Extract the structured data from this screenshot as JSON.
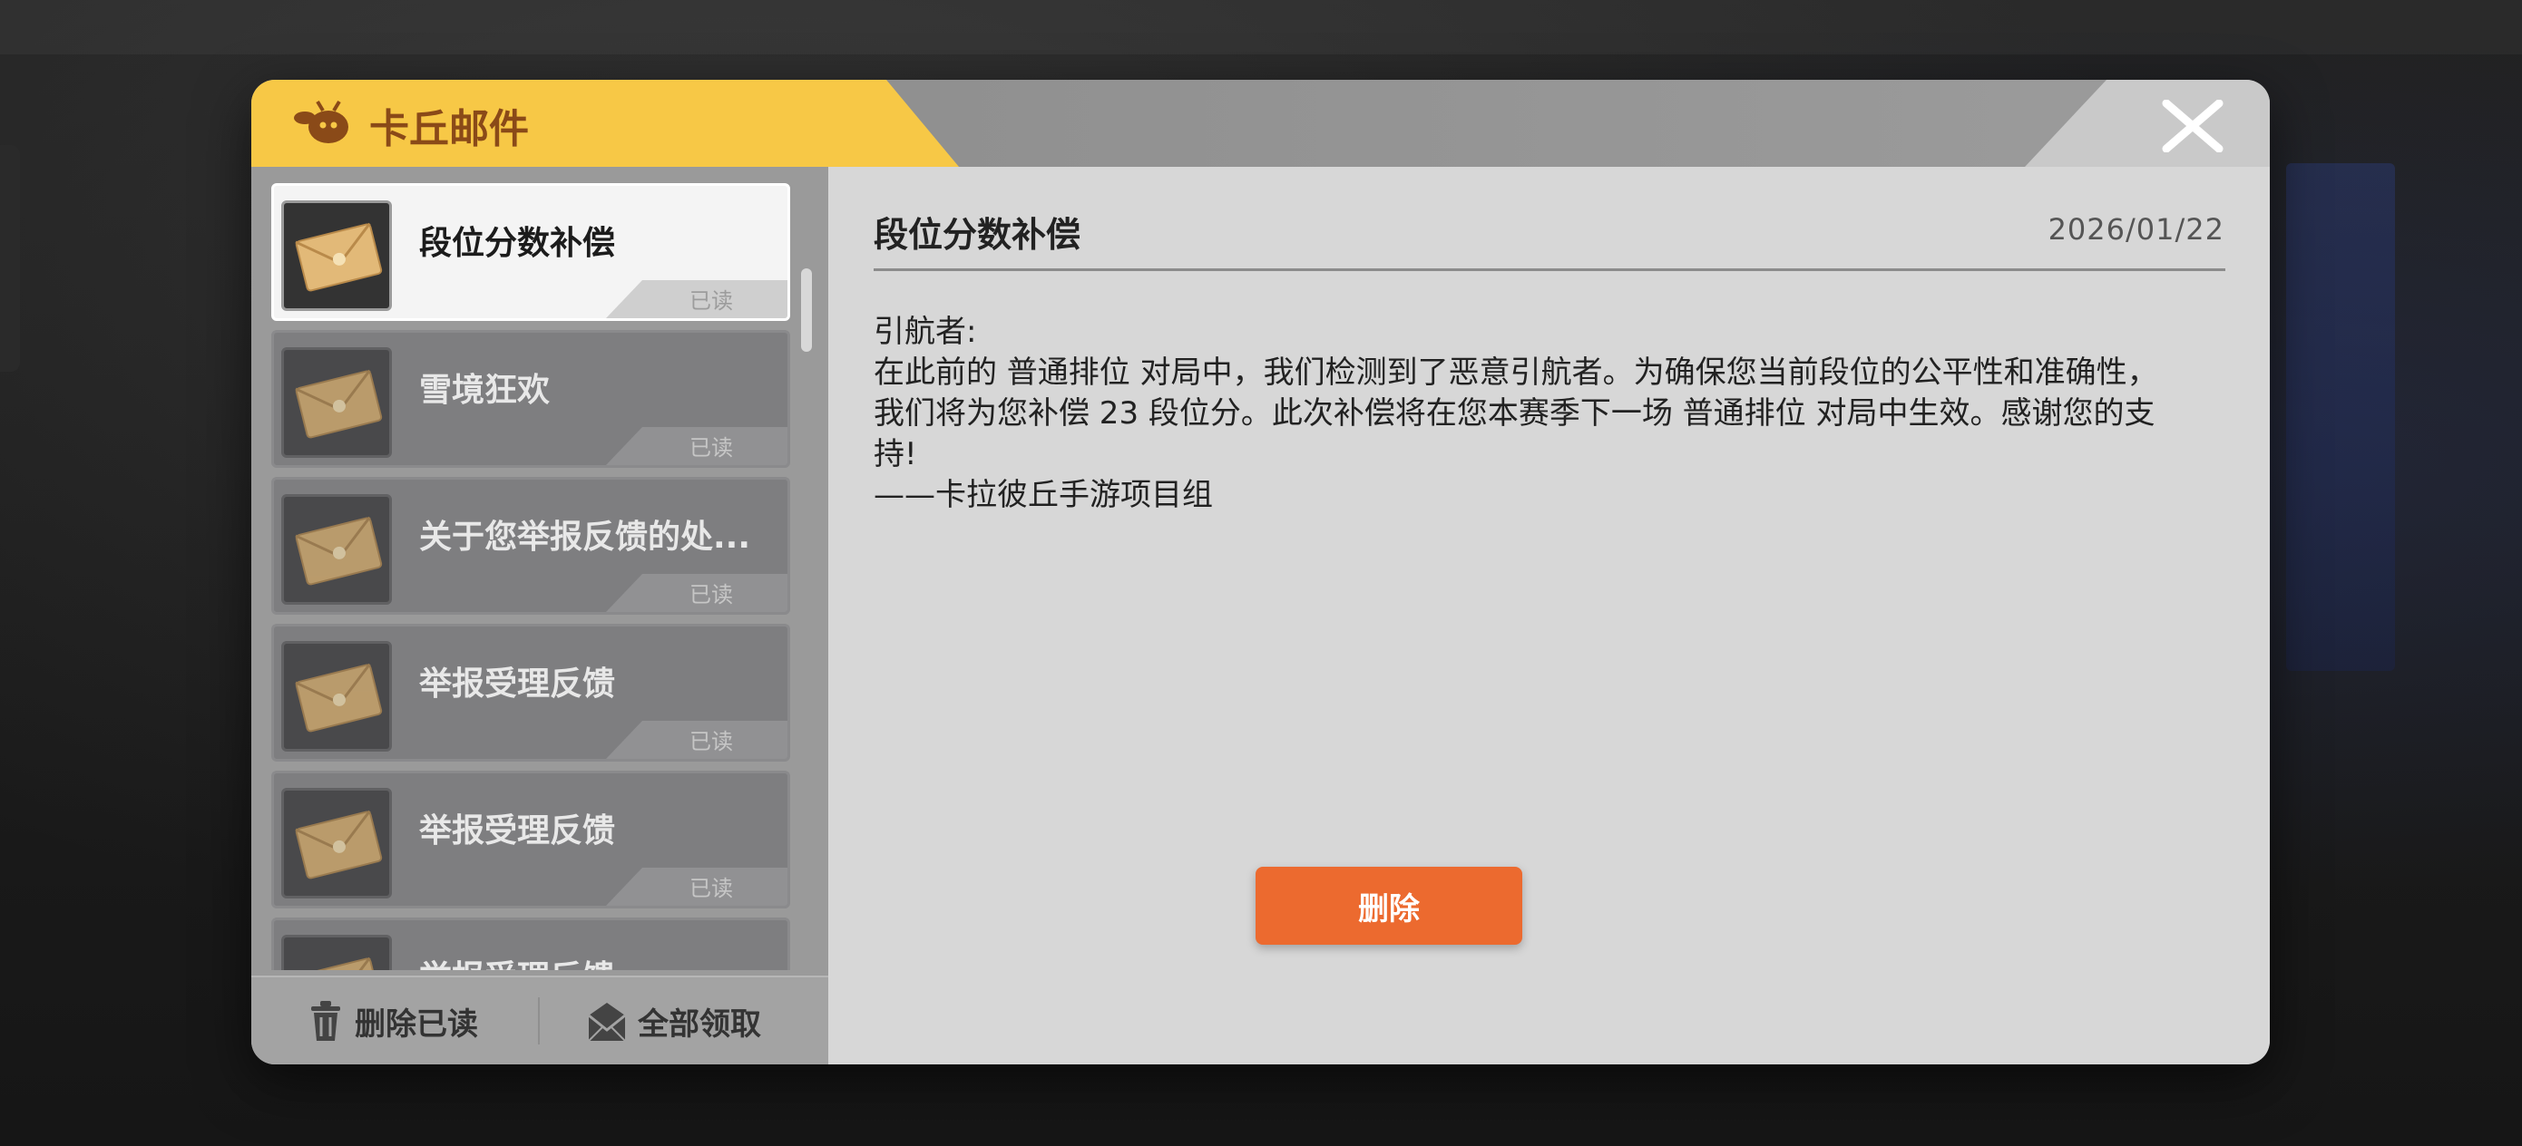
{
  "modal": {
    "title": "卡丘邮件",
    "logo_icon": "bee-mascot-icon",
    "close_icon": "close-x-icon"
  },
  "mail_list": [
    {
      "title": "段位分数补偿",
      "status": "已读",
      "selected": true
    },
    {
      "title": "雪境狂欢",
      "status": "已读",
      "selected": false
    },
    {
      "title": "关于您举报反馈的处...",
      "status": "已读",
      "selected": false
    },
    {
      "title": "举报受理反馈",
      "status": "已读",
      "selected": false
    },
    {
      "title": "举报受理反馈",
      "status": "已读",
      "selected": false
    },
    {
      "title": "举报受理反馈",
      "status": "",
      "selected": false
    }
  ],
  "footer": {
    "delete_read_label": "删除已读",
    "delete_read_icon": "trash-icon",
    "claim_all_label": "全部领取",
    "claim_all_icon": "mail-icon"
  },
  "content": {
    "title": "段位分数补偿",
    "date": "2026/01/22",
    "body_lines": [
      "引航者:",
      "在此前的 普通排位 对局中，我们检测到了恶意引航者。为确保您当前段位的公平性和准确性，",
      "我们将为您补偿 23 段位分。此次补偿将在您本赛季下一场 普通排位 对局中生效。感谢您的支",
      "持!",
      "——卡拉彼丘手游项目组"
    ],
    "delete_label": "删除"
  },
  "colors": {
    "accent_yellow": "#f7c846",
    "title_brown": "#8a4a18",
    "delete_orange": "#ec6a2f"
  }
}
